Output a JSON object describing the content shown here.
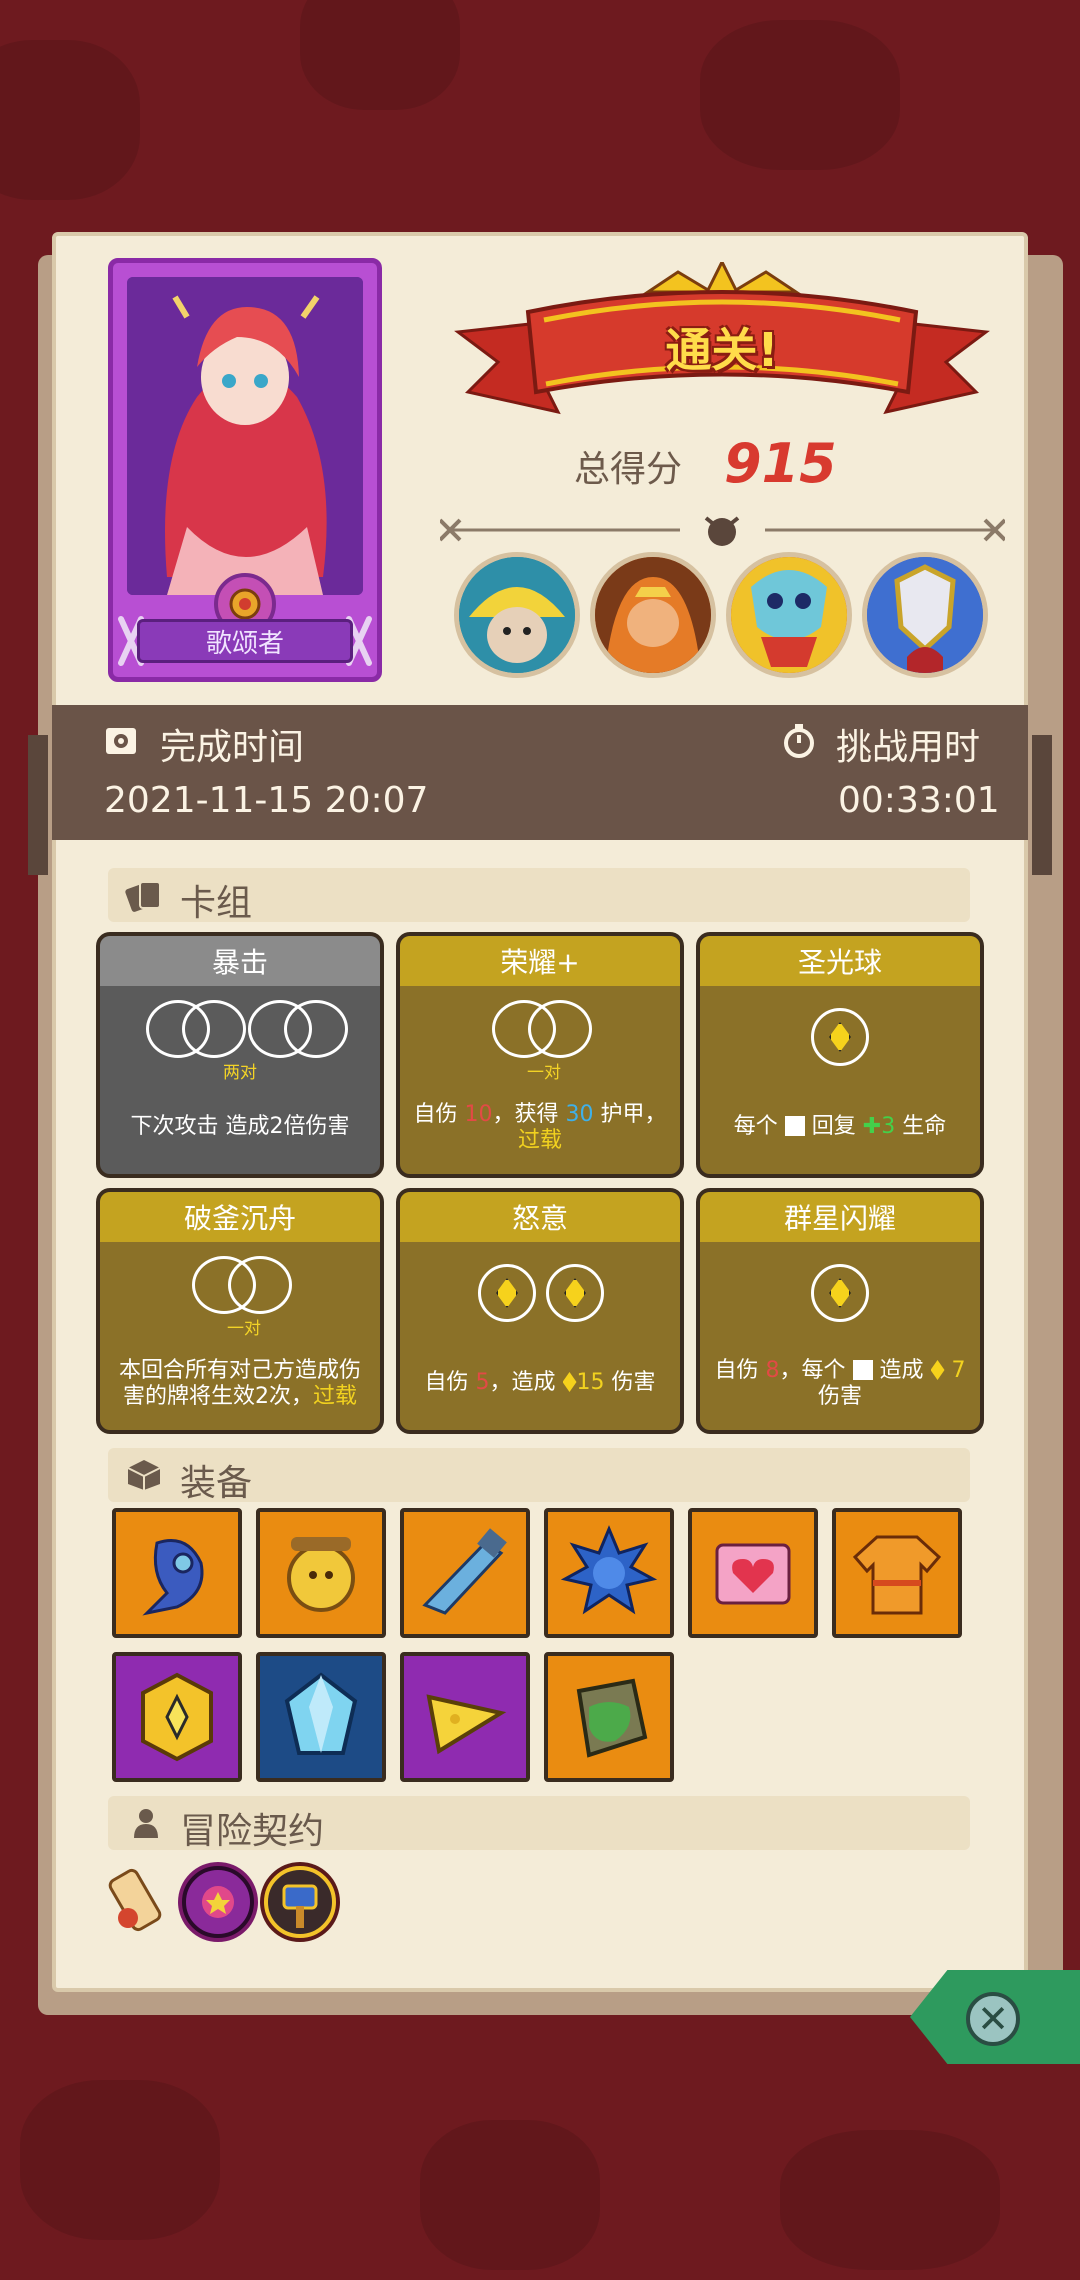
{
  "hero": {
    "name": "歌颂者"
  },
  "banner": {
    "title": "通关!"
  },
  "score": {
    "label": "总得分",
    "value": "915"
  },
  "bosses": [
    "boss-straw-hat",
    "boss-orange-monk",
    "boss-skull-mask",
    "boss-armored-knight"
  ],
  "time": {
    "completion_label": "完成时间",
    "completion_value": "2021-11-15 20:07",
    "challenge_label": "挑战用时",
    "challenge_value": "00:33:01"
  },
  "sections": {
    "deck": "卡组",
    "equipment": "装备",
    "contracts": "冒险契约"
  },
  "cards": [
    {
      "title": "暴击",
      "dice": "两对",
      "desc": "下次攻击 造成2倍伤害",
      "style": "gray"
    },
    {
      "title": "荣耀+",
      "dice": "一对",
      "desc_parts": {
        "a": "自伤",
        "b": "10",
        "c": "，获得",
        "d": "30",
        "e": "护甲，",
        "f": "过载"
      },
      "style": "gold"
    },
    {
      "title": "圣光球",
      "desc_parts": {
        "a": "每个",
        "b": "回复",
        "c": "3",
        "d": "生命"
      },
      "style": "gold"
    },
    {
      "title": "破釜沉舟",
      "dice": "一对",
      "desc_parts": {
        "a": "本回合所有对己方造成伤害的牌将生效2次，",
        "b": "过载"
      },
      "style": "gold"
    },
    {
      "title": "怒意",
      "desc_parts": {
        "a": "自伤",
        "b": "5",
        "c": "，造成",
        "d": "15",
        "e": "伤害"
      },
      "style": "gold"
    },
    {
      "title": "群星闪耀",
      "desc_parts": {
        "a": "自伤",
        "b": "8",
        "c": "，每个",
        "d": "造成",
        "e": "7",
        "f": "伤害"
      },
      "style": "gold"
    }
  ],
  "equipment": [
    {
      "icon": "plague-mask-icon",
      "rarity": "orange"
    },
    {
      "icon": "lion-ring-icon",
      "rarity": "orange"
    },
    {
      "icon": "blade-icon",
      "rarity": "orange"
    },
    {
      "icon": "spiked-ball-icon",
      "rarity": "orange"
    },
    {
      "icon": "heart-box-icon",
      "rarity": "orange"
    },
    {
      "icon": "sweater-icon",
      "rarity": "orange"
    },
    {
      "icon": "gold-amulet-icon",
      "rarity": "purple"
    },
    {
      "icon": "crystal-icon",
      "rarity": "navy"
    },
    {
      "icon": "cheese-icon",
      "rarity": "purple"
    },
    {
      "icon": "moss-stone-icon",
      "rarity": "orange"
    }
  ],
  "contracts": [
    "scroll-icon",
    "purple-seal-icon",
    "hammer-badge-icon"
  ],
  "colors": {
    "accent_red": "#d83a2f",
    "panel": "#f4ecd8",
    "bar": "#6a5448",
    "close": "#2e9a5e"
  }
}
